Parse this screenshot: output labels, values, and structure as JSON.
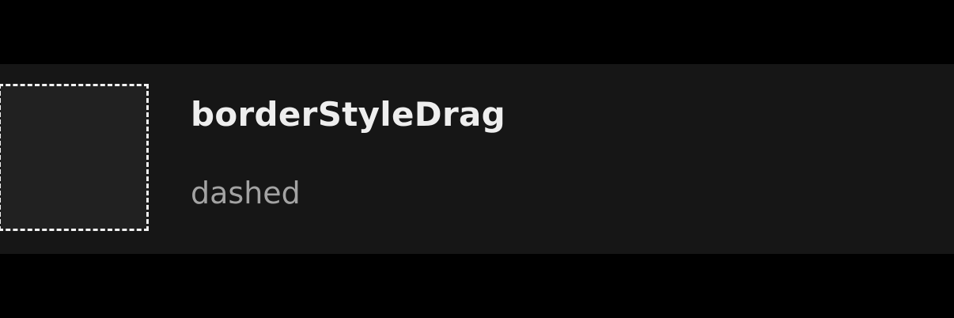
{
  "property": {
    "name": "borderStyleDrag",
    "value": "dashed"
  },
  "colors": {
    "background": "#000000",
    "card": "#161616",
    "swatch_fill": "#212121",
    "swatch_border": "#f2f2f2",
    "title": "#eeeeee",
    "value": "#a3a3a3"
  }
}
